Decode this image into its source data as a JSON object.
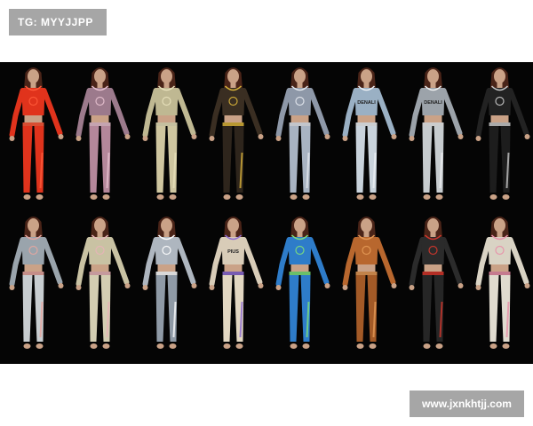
{
  "watermark_top": {
    "text": "TG: MYYJJPP"
  },
  "watermark_bottom": {
    "text": "www.jxnkhtjj.com"
  },
  "preview": {
    "background": "#050505",
    "skin": "#caa287",
    "hair": "#4a2418",
    "rows": [
      [
        {
          "top": "#e0331c",
          "pants": "#e0331c",
          "accent": "#ff5a3a",
          "graphic": ""
        },
        {
          "top": "#9c7a8c",
          "pants": "#b4879a",
          "accent": "#e7c1cf",
          "graphic": ""
        },
        {
          "top": "#bfb892",
          "pants": "#cfc6a0",
          "accent": "#e8e1bb",
          "graphic": ""
        },
        {
          "top": "#3a2e22",
          "pants": "#2e251c",
          "accent": "#d8b23a",
          "graphic": ""
        },
        {
          "top": "#8e98a8",
          "pants": "#a8b3c2",
          "accent": "#e4e8ee",
          "graphic": ""
        },
        {
          "top": "#9ab0c4",
          "pants": "#c9d3dc",
          "accent": "#eef2f6",
          "graphic": "DENALI"
        },
        {
          "top": "#9ca3aa",
          "pants": "#c7cccf",
          "accent": "#eef0f1",
          "graphic": "DENALI"
        },
        {
          "top": "#222222",
          "pants": "#1d1d1d",
          "accent": "#c8c8c8",
          "graphic": ""
        }
      ],
      [
        {
          "top": "#9aa4ac",
          "pants": "#c8cdd0",
          "accent": "#e6a6a0",
          "graphic": ""
        },
        {
          "top": "#c9c2a3",
          "pants": "#d3cdb2",
          "accent": "#e8b4b8",
          "graphic": ""
        },
        {
          "top": "#aeb6bf",
          "pants": "#8f9aa6",
          "accent": "#ffffff",
          "graphic": ""
        },
        {
          "top": "#d8ccb8",
          "pants": "#e2d7c2",
          "accent": "#8d6bd1",
          "graphic": "PIUS"
        },
        {
          "top": "#2e7cc9",
          "pants": "#2e7cc9",
          "accent": "#7ee07a",
          "graphic": ""
        },
        {
          "top": "#b8672e",
          "pants": "#a35a27",
          "accent": "#e49a57",
          "graphic": ""
        },
        {
          "top": "#2b2b2b",
          "pants": "#262626",
          "accent": "#d4362c",
          "graphic": ""
        },
        {
          "top": "#d9d3c4",
          "pants": "#e0dbcf",
          "accent": "#e88fa8",
          "graphic": ""
        }
      ]
    ]
  }
}
